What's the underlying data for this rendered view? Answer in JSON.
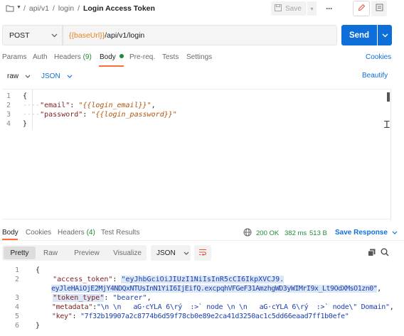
{
  "breadcrumb": {
    "parts": [
      "/",
      "api/v1",
      "/",
      "login",
      "/"
    ],
    "current": "Login Access Token"
  },
  "toolbar": {
    "save_label": "Save",
    "more_label": "···"
  },
  "request": {
    "method": "POST",
    "url_var": "{{baseUrl}}",
    "url_path": "/api/v1/login",
    "send_label": "Send"
  },
  "request_tabs": {
    "params": "Params",
    "auth": "Auth",
    "headers": "Headers",
    "headers_count": "(9)",
    "body": "Body",
    "prereq": "Pre-req.",
    "tests": "Tests",
    "settings": "Settings",
    "cookies": "Cookies"
  },
  "body_options": {
    "mode": "raw",
    "language": "JSON",
    "beautify": "Beautify"
  },
  "request_body": {
    "line_numbers": [
      "1",
      "2",
      "3",
      "4"
    ],
    "open_brace": "{",
    "close_brace": "}",
    "email_key": "\"email\"",
    "email_value": "\"{{login_email}}\"",
    "password_key": "\"password\"",
    "password_value": "\"{{login_password}}\"",
    "colon": ":",
    "comma": ","
  },
  "response_tabs": {
    "body": "Body",
    "cookies": "Cookies",
    "headers": "Headers",
    "headers_count": "(4)",
    "test_results": "Test Results",
    "status": "200 OK",
    "time": "382 ms",
    "size": "513 B",
    "save_response": "Save Response"
  },
  "view_modes": {
    "pretty": "Pretty",
    "raw": "Raw",
    "preview": "Preview",
    "visualize": "Visualize",
    "format": "JSON"
  },
  "response_body": {
    "line_numbers": [
      "1",
      "2",
      "",
      "3",
      "4",
      "5",
      "6"
    ],
    "open_brace": "{",
    "close_brace": "}",
    "access_token_key": "\"access_token\"",
    "access_token_value_1": "\"eyJhbGciOiJIUzI1NiIsInR5cCI6IkpXVCJ9.",
    "access_token_value_2": "eyJleHAiOjE2MjY4NDQxNTUsInN1YiI6IjEifQ.excpqhVFGeF31AmzhgWD3yWIMrI9x_Lt9OdXMsO1zn0\"",
    "token_type_key": "\"token_type\"",
    "token_type_value": "\"bearer\"",
    "metadata_key": "\"metadata\"",
    "metadata_value": "\"\\n \\n   aG·cYLA 6\\rý  :>` node \\n \\n   aG·cYLA 6\\rý  :>` node\\\" Domain\"",
    "key_key": "\"key\"",
    "key_value": "\"7f32b19907a2c8774b6d59f78cb0e89e2ca41d3250ac1c5dd66eaad7ff1b0efe\""
  },
  "colors": {
    "accent": "#0f6fd9",
    "status_green": "#1f8a3a",
    "body_dot": "#1f8a3a",
    "tab_underline": "#ff6c37"
  },
  "icons": [
    "folder-icon",
    "caret-down-icon",
    "save-icon",
    "edit-icon",
    "comments-icon",
    "globe-icon",
    "copy-icon",
    "search-icon",
    "wrap-lines-icon"
  ]
}
